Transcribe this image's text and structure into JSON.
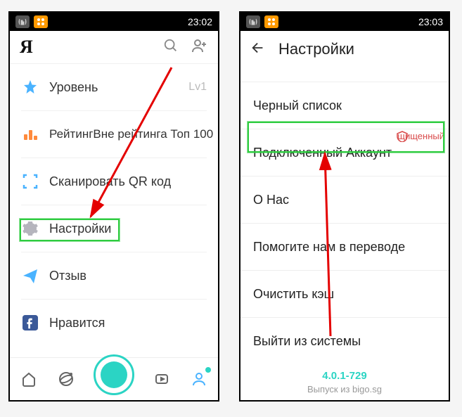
{
  "left": {
    "status_time": "23:02",
    "header_letter": "Я",
    "items": [
      {
        "label": "Уровень",
        "value": "Lv1"
      },
      {
        "label": "РейтингВне рейтинга Топ 100",
        "value": ""
      },
      {
        "label": "Сканировать QR код",
        "value": ""
      },
      {
        "label": "Настройки",
        "value": ""
      },
      {
        "label": "Отзыв",
        "value": ""
      },
      {
        "label": "Нравится",
        "value": ""
      }
    ]
  },
  "right": {
    "status_time": "23:03",
    "title": "Настройки",
    "items": [
      "Черный список",
      "Подключенный Аккаунт",
      "О Нас",
      "Помогите нам в переводе",
      "Очистить кэш",
      "Выйти из системы"
    ],
    "version": "4.0.1-729",
    "version_sub": "Выпуск из bigo.sg",
    "overlay_text": "щищенный"
  }
}
